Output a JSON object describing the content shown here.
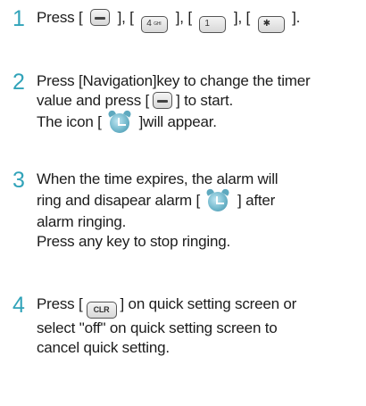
{
  "steps": [
    {
      "number": "1",
      "text": {
        "a": "Press [",
        "b": "],",
        "c": "[",
        "d": "],",
        "e": "[",
        "f": "],",
        "g": "[",
        "h": "]."
      },
      "keys": {
        "num4_digit": "4",
        "num4_letters": "GHI",
        "num1_digit": "1",
        "star_symbol": "✱"
      }
    },
    {
      "number": "2",
      "text": {
        "line1": "Press [Navigation]key to change the timer",
        "line2a": "value and press [",
        "line2b": "] to start.",
        "line3a": "The icon [",
        "line3b": "]will appear."
      }
    },
    {
      "number": "3",
      "text": {
        "line1": "When the time expires, the alarm will",
        "line2a": "ring and disapear alarm [",
        "line2b": "] after",
        "line3": "alarm ringing.",
        "line4": "Press any key to stop ringing."
      }
    },
    {
      "number": "4",
      "text": {
        "line1a": "Press [",
        "line1b": "] on quick setting screen or",
        "line2": "select \"off\" on quick setting screen to",
        "line3": "cancel quick setting."
      },
      "keys": {
        "clear_label": "CLR"
      }
    }
  ],
  "colors": {
    "step_number": "#31a3b9",
    "body_text": "#1c1c1c"
  },
  "icons": {
    "soft_key": "soft-key-icon",
    "alarm": "alarm-clock-icon",
    "clear_key": "clear-key-icon"
  }
}
